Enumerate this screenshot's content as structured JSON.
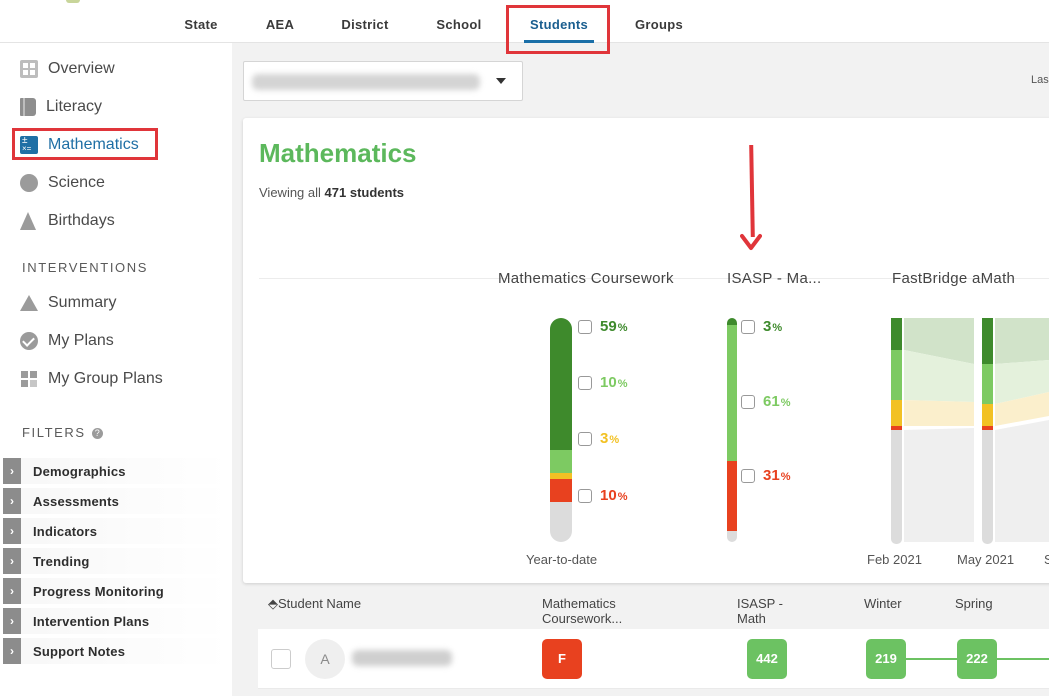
{
  "nav": {
    "tabs": [
      {
        "label": "State"
      },
      {
        "label": "AEA"
      },
      {
        "label": "District"
      },
      {
        "label": "School"
      },
      {
        "label": "Students",
        "active": true
      },
      {
        "label": "Groups"
      }
    ]
  },
  "sidebar": {
    "items": [
      {
        "label": "Overview",
        "icon": "overview-icon"
      },
      {
        "label": "Literacy",
        "icon": "book-icon"
      },
      {
        "label": "Mathematics",
        "icon": "math-icon",
        "active": true
      },
      {
        "label": "Science",
        "icon": "science-icon"
      },
      {
        "label": "Birthdays",
        "icon": "party-hat-icon"
      }
    ],
    "interventions_heading": "INTERVENTIONS",
    "interventions": [
      {
        "label": "Summary",
        "icon": "pyramid-icon"
      },
      {
        "label": "My Plans",
        "icon": "check-circle-icon"
      },
      {
        "label": "My Group Plans",
        "icon": "grid-icon"
      }
    ],
    "filters_heading": "FILTERS",
    "help_glyph": "?",
    "filters": [
      {
        "label": "Demographics"
      },
      {
        "label": "Assessments"
      },
      {
        "label": "Indicators"
      },
      {
        "label": "Trending"
      },
      {
        "label": "Progress Monitoring"
      },
      {
        "label": "Intervention Plans"
      },
      {
        "label": "Support Notes"
      }
    ]
  },
  "header": {
    "last_label": "Las"
  },
  "card": {
    "title": "Mathematics",
    "viewing_prefix": "Viewing all ",
    "viewing_count": "471 students",
    "columns": [
      {
        "title": "Mathematics Coursework",
        "footer": "Year-to-date",
        "segments": [
          {
            "pct": 59,
            "color": "#3e8a2c"
          },
          {
            "pct": 10,
            "color": "#7dca62"
          },
          {
            "pct": 3,
            "color": "#f2c124"
          },
          {
            "pct": 10,
            "color": "#e8411f"
          },
          {
            "pct": 18,
            "color": "#dcdcdc"
          }
        ],
        "labels": [
          {
            "value": "59",
            "unit": "%",
            "color": "#3e8a2c"
          },
          {
            "value": "10",
            "unit": "%",
            "color": "#7dca62"
          },
          {
            "value": "3",
            "unit": "%",
            "color": "#f2c124"
          },
          {
            "value": "10",
            "unit": "%",
            "color": "#e8411f"
          }
        ]
      },
      {
        "title": "ISASP - Ma...",
        "segments": [
          {
            "pct": 3,
            "color": "#3e8a2c"
          },
          {
            "pct": 61,
            "color": "#7dca62"
          },
          {
            "pct": 31,
            "color": "#e8411f"
          },
          {
            "pct": 5,
            "color": "#dcdcdc"
          }
        ],
        "labels": [
          {
            "value": "3",
            "unit": "%",
            "color": "#3e8a2c"
          },
          {
            "value": "61",
            "unit": "%",
            "color": "#7dca62"
          },
          {
            "value": "31",
            "unit": "%",
            "color": "#e8411f"
          }
        ]
      },
      {
        "title": "FastBridge aMath",
        "periods": [
          "Feb 2021",
          "May 2021"
        ],
        "period_clipped": "S"
      }
    ]
  },
  "table": {
    "headers": {
      "student": "Student Name",
      "sort_glyph": "⬘",
      "coursework_line1": "Mathematics",
      "coursework_line2": "Coursework...",
      "isasp_line1": "ISASP -",
      "isasp_line2": "Math",
      "winter": "Winter",
      "spring": "Spring"
    },
    "rows": [
      {
        "initial": "A",
        "coursework": "F",
        "isasp": "442",
        "winter": "219",
        "spring": "222"
      }
    ]
  },
  "colors": {
    "accent": "#1f6fa5",
    "title_green": "#5cb85c",
    "highlight_red": "#e0353a",
    "grade_red": "#e8411f",
    "score_green": "#6cc262"
  }
}
